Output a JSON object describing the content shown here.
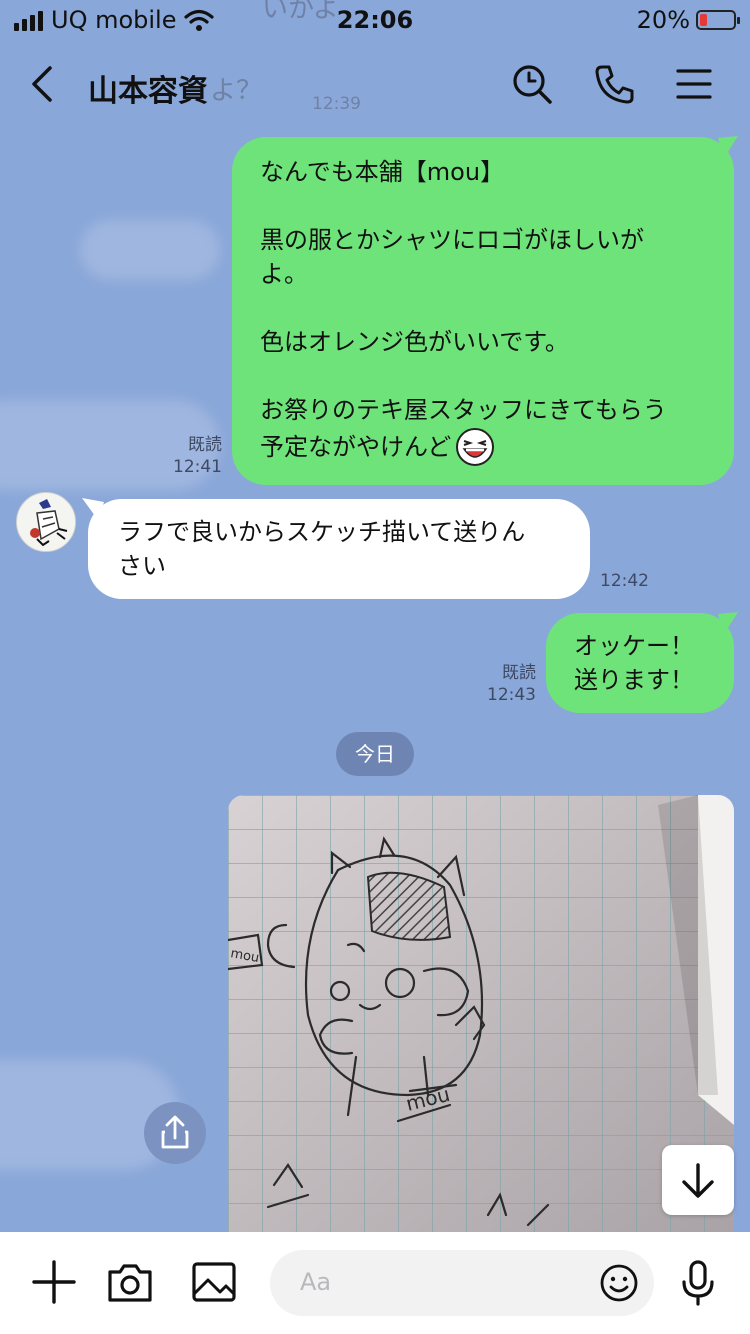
{
  "status": {
    "carrier": "UQ mobile",
    "time": "22:06",
    "battery": "20%",
    "battery_level": 0.2
  },
  "header": {
    "title": "山本容資",
    "ghost_top": "いかよ",
    "ghost_mid": "よ？",
    "ghost_time": "12:39"
  },
  "messages": [
    {
      "from": "me",
      "lines": [
        "なんでも本舗【mou】",
        "",
        "黒の服とかシャツにロゴがほしいが",
        "よ。",
        "",
        "色はオレンジ色がいいです。",
        "",
        "お祭りのテキ屋スタッフにきてもらう",
        "予定ながやけんど"
      ],
      "emoji": "laughing-face-icon",
      "read": "既読",
      "time": "12:41"
    },
    {
      "from": "them",
      "lines": [
        "ラフで良いからスケッチ描いて送りん",
        "さい"
      ],
      "time": "12:42"
    },
    {
      "from": "me",
      "lines": [
        "オッケー！",
        "送ります！"
      ],
      "read": "既読",
      "time": "12:43"
    }
  ],
  "date_separator": "今日",
  "image_message": {
    "sketch_text": "mou"
  },
  "input": {
    "placeholder": "Aa"
  },
  "colors": {
    "background": "#8aa7d9",
    "my_bubble": "#6ee37a",
    "their_bubble": "#ffffff",
    "battery_low": "#e53935"
  }
}
